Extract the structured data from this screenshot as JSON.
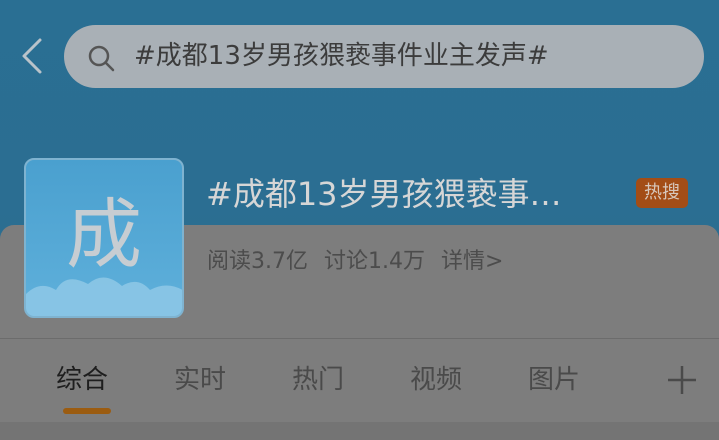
{
  "search": {
    "query": "#成都13岁男孩猥亵事件业主发声#"
  },
  "topic": {
    "avatar_char": "成",
    "title": "#成都13岁男孩猥亵事…",
    "hot_badge": "热搜",
    "reads": "阅读3.7亿",
    "discussions": "讨论1.4万",
    "details": "详情>"
  },
  "tabs": [
    {
      "label": "综合",
      "active": true
    },
    {
      "label": "实时",
      "active": false
    },
    {
      "label": "热门",
      "active": false
    },
    {
      "label": "视频",
      "active": false
    },
    {
      "label": "图片",
      "active": false
    }
  ],
  "colors": {
    "header": "#2b6e92",
    "hot_badge": "#a34d16",
    "tab_underline": "#9b5c11"
  },
  "icons": [
    "back-chevron-icon",
    "search-icon",
    "plus-icon"
  ]
}
